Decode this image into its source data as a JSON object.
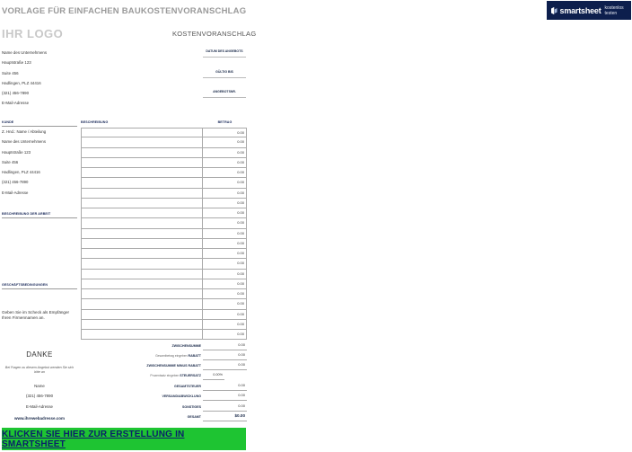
{
  "page_title": "VORLAGE FÜR EINFACHEN BAUKOSTENVORANSCHLAG",
  "brand": {
    "name": "smartsheet",
    "cta": "kostenlos testen",
    "bg_color": "#0d1f4d"
  },
  "logo_placeholder": "IHR LOGO",
  "doc_title": "KOSTENVORANSCHLAG",
  "company": [
    "Name des Unternehmens",
    "Hauptstraße 123",
    "Suite 456",
    "Hadlingen, PLZ 44416",
    "(321) 456-7890",
    "E-Mail-Adresse"
  ],
  "meta": {
    "date_label": "DATUM DES ANGEBOTS",
    "valid_label": "GÜLTIG BIS",
    "number_label": "ANGEBOTSNR."
  },
  "sections": {
    "customer": "KUNDE",
    "description": "BESCHREIBUNG",
    "amount": "BETRAG",
    "scope": "BESCHREIBUNG DER ARBEIT",
    "terms": "GESCHÄFTSBEDINGUNGEN"
  },
  "customer": [
    "Z. Hnd.: Name / Abteilung",
    "Name des Unternehmens",
    "Hauptstraße 123",
    "Suite 456",
    "Hadlingen, PLZ 44416",
    "(321) 456-7890",
    "E-Mail-Adresse"
  ],
  "line_amounts": [
    "0.00",
    "0.00",
    "0.00",
    "0.00",
    "0.00",
    "0.00",
    "0.00",
    "0.00",
    "0.00",
    "0.00",
    "0.00",
    "0.00",
    "0.00",
    "0.00",
    "0.00",
    "0.00",
    "0.00",
    "0.00",
    "0.00",
    "0.00",
    "0.00"
  ],
  "payment_note": "Geben Sie im Scheck als Empfänger Ihren Firmennamen an.",
  "thanks": "DANKE",
  "questions": "Bei Fragen zu diesem Angebot wenden Sie sich bitte an",
  "contact": {
    "name": "Name",
    "phone": "(321) 456-7890",
    "email": "E-Mail-Adresse",
    "web": "www.ihrewebadresse.com"
  },
  "summary": {
    "subtotal_label": "ZWISCHENSUMME",
    "subtotal": "0.00",
    "discount_sub": "Gesamtbetrag eingeben",
    "discount_label": "RABATT",
    "discount": "0.00",
    "subtotal_less_label": "ZWISCHENSUMME MINUS RABATT",
    "subtotal_less": "0.00",
    "taxrate_sub": "Prozentsatz eingeben",
    "taxrate_label": "STEUERSATZ",
    "taxrate": "0.00%",
    "tax_label": "GESAMTSTEUER",
    "tax": "0.00",
    "shipping_label": "VERSAND/ABWICKLUNG",
    "shipping": "0.00",
    "other_label": "SONSTIGES",
    "other": "0.00",
    "total_label": "GESAMT",
    "total": "$0.00"
  },
  "cta_label": "KLICKEN SIE HIER ZUR ERSTELLUNG IN SMARTSHEET",
  "colors": {
    "cta_bg": "#1ec432",
    "cta_text": "#0a1f6a",
    "heading": "#1a2a5a"
  }
}
